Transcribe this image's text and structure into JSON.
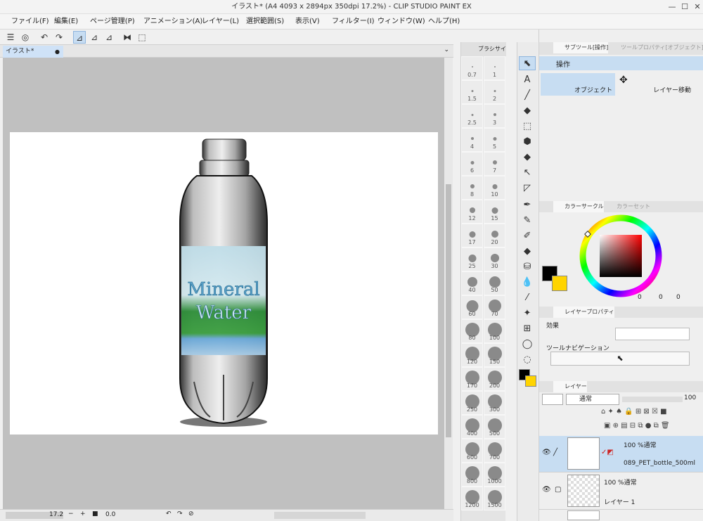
{
  "window": {
    "title": "イラスト* (A4 4093 x 2894px 350dpi 17.2%) - CLIP STUDIO PAINT EX"
  },
  "menu": [
    "ファイル(F)",
    "編集(E)",
    "ページ管理(P)",
    "アニメーション(A)",
    "レイヤー(L)",
    "選択範囲(S)",
    "表示(V)",
    "フィルター(I)",
    "ウィンドウ(W)",
    "ヘルプ(H)"
  ],
  "document": {
    "tab": "イラスト*",
    "tab_dot": "●"
  },
  "artwork": {
    "label_line1": "Mineral",
    "label_line2": "Water"
  },
  "status": {
    "zoom": "17.2",
    "rotation": "0.0"
  },
  "brush_sizes": [
    "0.7",
    "1",
    "1.5",
    "2",
    "2.5",
    "3",
    "4",
    "5",
    "6",
    "7",
    "8",
    "10",
    "12",
    "15",
    "17",
    "20",
    "25",
    "30",
    "40",
    "50",
    "60",
    "70",
    "80",
    "100",
    "120",
    "150",
    "170",
    "200",
    "250",
    "300",
    "400",
    "500",
    "600",
    "700",
    "800",
    "1000",
    "1200",
    "1500"
  ],
  "brush_panel": {
    "tab": "ブラシサイ"
  },
  "sub_tool": {
    "tab_active": "サブツール[操作]",
    "tab_inactive": "ツールプロパティ[オブジェクト]",
    "group": "操作",
    "items": [
      "オブジェクト",
      "レイヤー移動"
    ]
  },
  "color": {
    "tab_active": "カラーサークル",
    "tab_inactive": "カラーセット",
    "main": "#000000",
    "sub": "#ffd400",
    "values": [
      "0",
      "0",
      "0"
    ]
  },
  "layer_property": {
    "tab": "レイヤープロパティ",
    "effect_label": "効果",
    "nav_label": "ツールナビゲーション"
  },
  "layers": {
    "tab": "レイヤー",
    "blend_mode": "通常",
    "opacity": "100",
    "items": [
      {
        "mode": "100 %通常",
        "name": "089_PET_bottle_500ml",
        "selected": true
      },
      {
        "mode": "100 %通常",
        "name": "レイヤー 1",
        "selected": false
      }
    ]
  },
  "colors": {
    "accent": "#c7ddf2",
    "canvas_bg": "#c0c0c0"
  }
}
